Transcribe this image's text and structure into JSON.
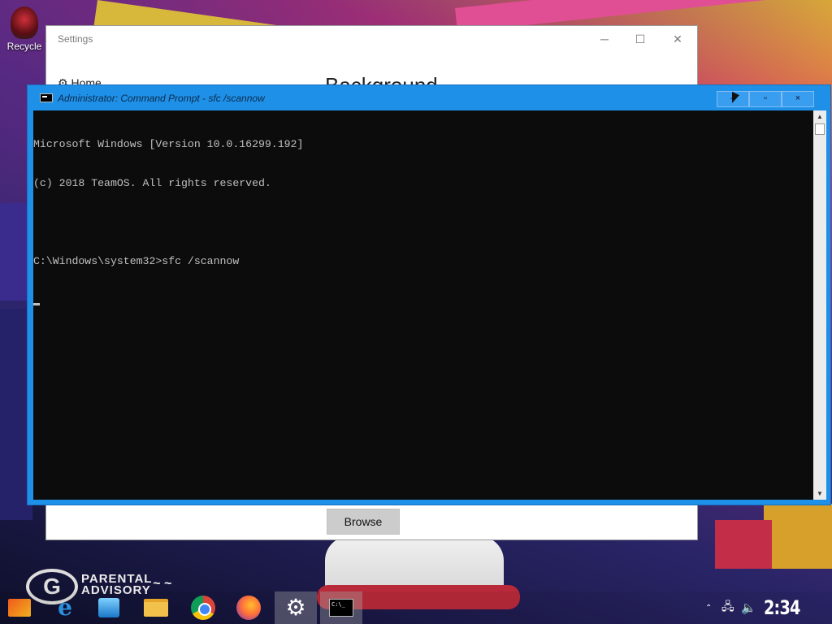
{
  "desktop": {
    "icons": [
      {
        "label": "Recycle"
      }
    ]
  },
  "settings_window": {
    "title": "Settings",
    "controls": {
      "minimize": "─",
      "maximize": "☐",
      "close": "✕"
    },
    "nav_home": "Home",
    "heading": "Background",
    "browse_button": "Browse"
  },
  "cmd_window": {
    "title": "Administrator: Command Prompt - sfc  /scannow",
    "buttons": {
      "minimize": "–",
      "restore": "▫",
      "close": "×"
    },
    "lines": [
      "Microsoft Windows [Version 10.0.16299.192]",
      "(c) 2018 TeamOS. All rights reserved.",
      "",
      "C:\\Windows\\system32>sfc /scannow"
    ],
    "scroll_up": "▲",
    "scroll_down": "▼"
  },
  "taskbar": {
    "items": [
      {
        "name": "start-button",
        "icon": "start-icon"
      },
      {
        "name": "internet-explorer",
        "icon": "ie-icon",
        "glyph": "e"
      },
      {
        "name": "media-player",
        "icon": "media-player-icon"
      },
      {
        "name": "file-explorer",
        "icon": "folder-icon"
      },
      {
        "name": "chrome",
        "icon": "chrome-icon"
      },
      {
        "name": "firefox",
        "icon": "firefox-icon"
      },
      {
        "name": "settings",
        "icon": "gear-icon",
        "glyph": "⚙"
      },
      {
        "name": "command-prompt",
        "icon": "cmd-icon",
        "glyph": "C:\\_"
      }
    ],
    "tray": {
      "chevron": "⌃",
      "network": "🖧",
      "volume": "🔈"
    },
    "clock": "2:34 AM"
  },
  "wallpaper_text": {
    "logo": "G",
    "advisory": "PARENTAL\nADVISORY",
    "signature": "signature"
  }
}
